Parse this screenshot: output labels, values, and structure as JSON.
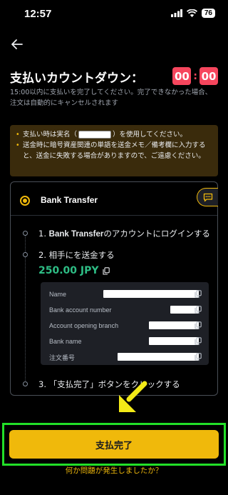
{
  "status_bar": {
    "time": "12:57",
    "battery": "76"
  },
  "header": {
    "title": "支払いカウントダウン：",
    "countdown_minutes": "00",
    "countdown_separator": ":",
    "countdown_seconds": "00"
  },
  "subtitle": "15:00以内に支払いを完了してください。完了できなかった場合、注文は自動的にキャンセルされます",
  "notice": {
    "line1_prefix": "支払い時は実名（",
    "line1_suffix": "）を使用してください。",
    "line2": "送金時に暗号資産関連の単語を送金メモ／備考欄に入力すると、送金に失敗する場合がありますので、ご遠慮ください。"
  },
  "payment": {
    "method": "Bank Transfer",
    "step1_prefix": "1. ",
    "step1_bold": "Bank Transfer",
    "step1_suffix": "のアカウントにログインする",
    "step2": "2. 相手にを送金する",
    "amount": "250.00 JPY",
    "details": [
      {
        "label": "Name"
      },
      {
        "label": "Bank account number"
      },
      {
        "label": "Account opening branch"
      },
      {
        "label": "Bank name"
      },
      {
        "label": "注文番号"
      }
    ],
    "step3": "3. 「支払完了」ボタンをクリックする"
  },
  "footer": {
    "pay_button": "支払完了",
    "help_link": "何か問題が発生しましたか？"
  },
  "colors": {
    "accent": "#f0b90b",
    "danger": "#f6465d",
    "success": "#2ebd85",
    "highlight": "#22e028"
  }
}
